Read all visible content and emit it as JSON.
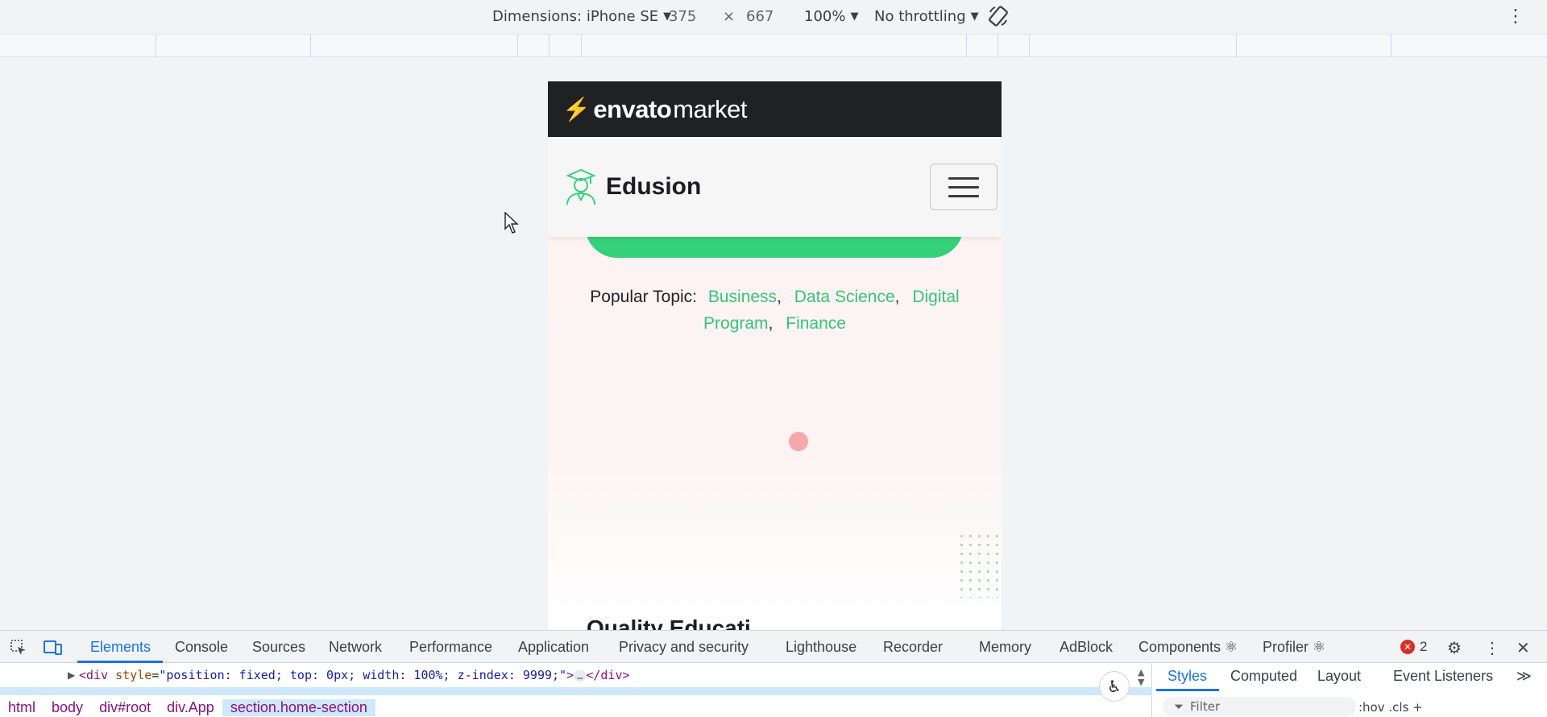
{
  "device_toolbar": {
    "dimensions_label": "Dimensions: iPhone SE",
    "width": "375",
    "times": "×",
    "height": "667",
    "zoom": "100%",
    "throttling": "No throttling"
  },
  "envato": {
    "bolt": "⚡",
    "brand_bold": "envato",
    "brand_light": "market"
  },
  "site": {
    "brand_name": "Edusion",
    "popular_label": "Popular Topic:",
    "topics": [
      "Business",
      "Data Science",
      "Digital Program",
      "Finance"
    ],
    "quality_heading": "Quality Educati..."
  },
  "devtools": {
    "tabs": [
      "Elements",
      "Console",
      "Sources",
      "Network",
      "Performance",
      "Application",
      "Privacy and security",
      "Lighthouse",
      "Recorder",
      "Memory",
      "AdBlock",
      "Components ⚛",
      "Profiler ⚛"
    ],
    "error_count": "2",
    "dom_line": {
      "open_tag": "<div",
      "attr_name": "style",
      "attr_value": "\"position: fixed; top: 0px; width: 100%; z-index: 9999;\"",
      "close": ">",
      "ellipsis": "…",
      "end_tag": "</div>"
    },
    "breadcrumb": [
      "html",
      "body",
      "div#root",
      "div.App",
      "section.home-section"
    ],
    "styles_tabs": [
      "Styles",
      "Computed",
      "Layout",
      "Event Listeners"
    ],
    "styles_more": "≫",
    "filter_placeholder": "Filter",
    "filter_extra": ":hov  .cls  +"
  },
  "colors": {
    "accent_green": "#34d17a",
    "devtools_blue": "#1a73e8",
    "envato_dark": "#1f2123"
  }
}
